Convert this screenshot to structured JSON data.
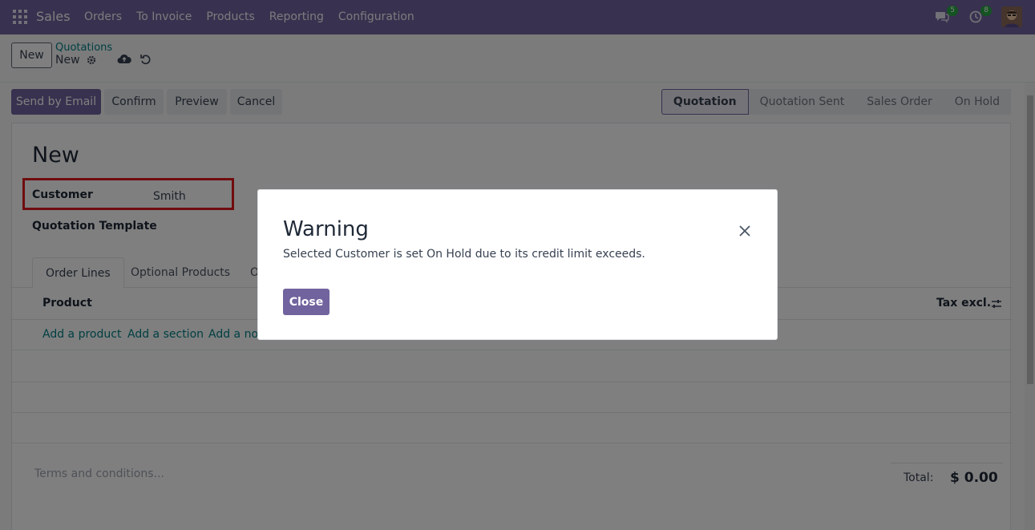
{
  "navbar": {
    "brand": "Sales",
    "menu": [
      "Orders",
      "To Invoice",
      "Products",
      "Reporting",
      "Configuration"
    ],
    "messages_count": "5",
    "activities_count": "8"
  },
  "control": {
    "new_label": "New",
    "breadcrumb_parent": "Quotations",
    "breadcrumb_current": "New"
  },
  "actions": {
    "send_email": "Send by Email",
    "confirm": "Confirm",
    "preview": "Preview",
    "cancel": "Cancel"
  },
  "status_stages": [
    "Quotation",
    "Quotation Sent",
    "Sales Order",
    "On Hold"
  ],
  "form": {
    "title": "New",
    "customer_label": "Customer",
    "customer_value": "Smith",
    "template_label": "Quotation Template",
    "tabs": [
      "Order Lines",
      "Optional Products",
      "O"
    ],
    "product_header": "Product",
    "tax_header": "Tax excl.",
    "add_product": "Add a product",
    "add_section": "Add a section",
    "add_note": "Add a not",
    "terms_placeholder": "Terms and conditions...",
    "total_label": "Total:",
    "total_value": "$ 0.00"
  },
  "modal": {
    "title": "Warning",
    "message": "Selected Customer is set On Hold due to its credit limit exceeds.",
    "close_label": "Close"
  },
  "colors": {
    "brand": "#71639e",
    "link": "#017e84",
    "highlight": "#e0191f"
  }
}
